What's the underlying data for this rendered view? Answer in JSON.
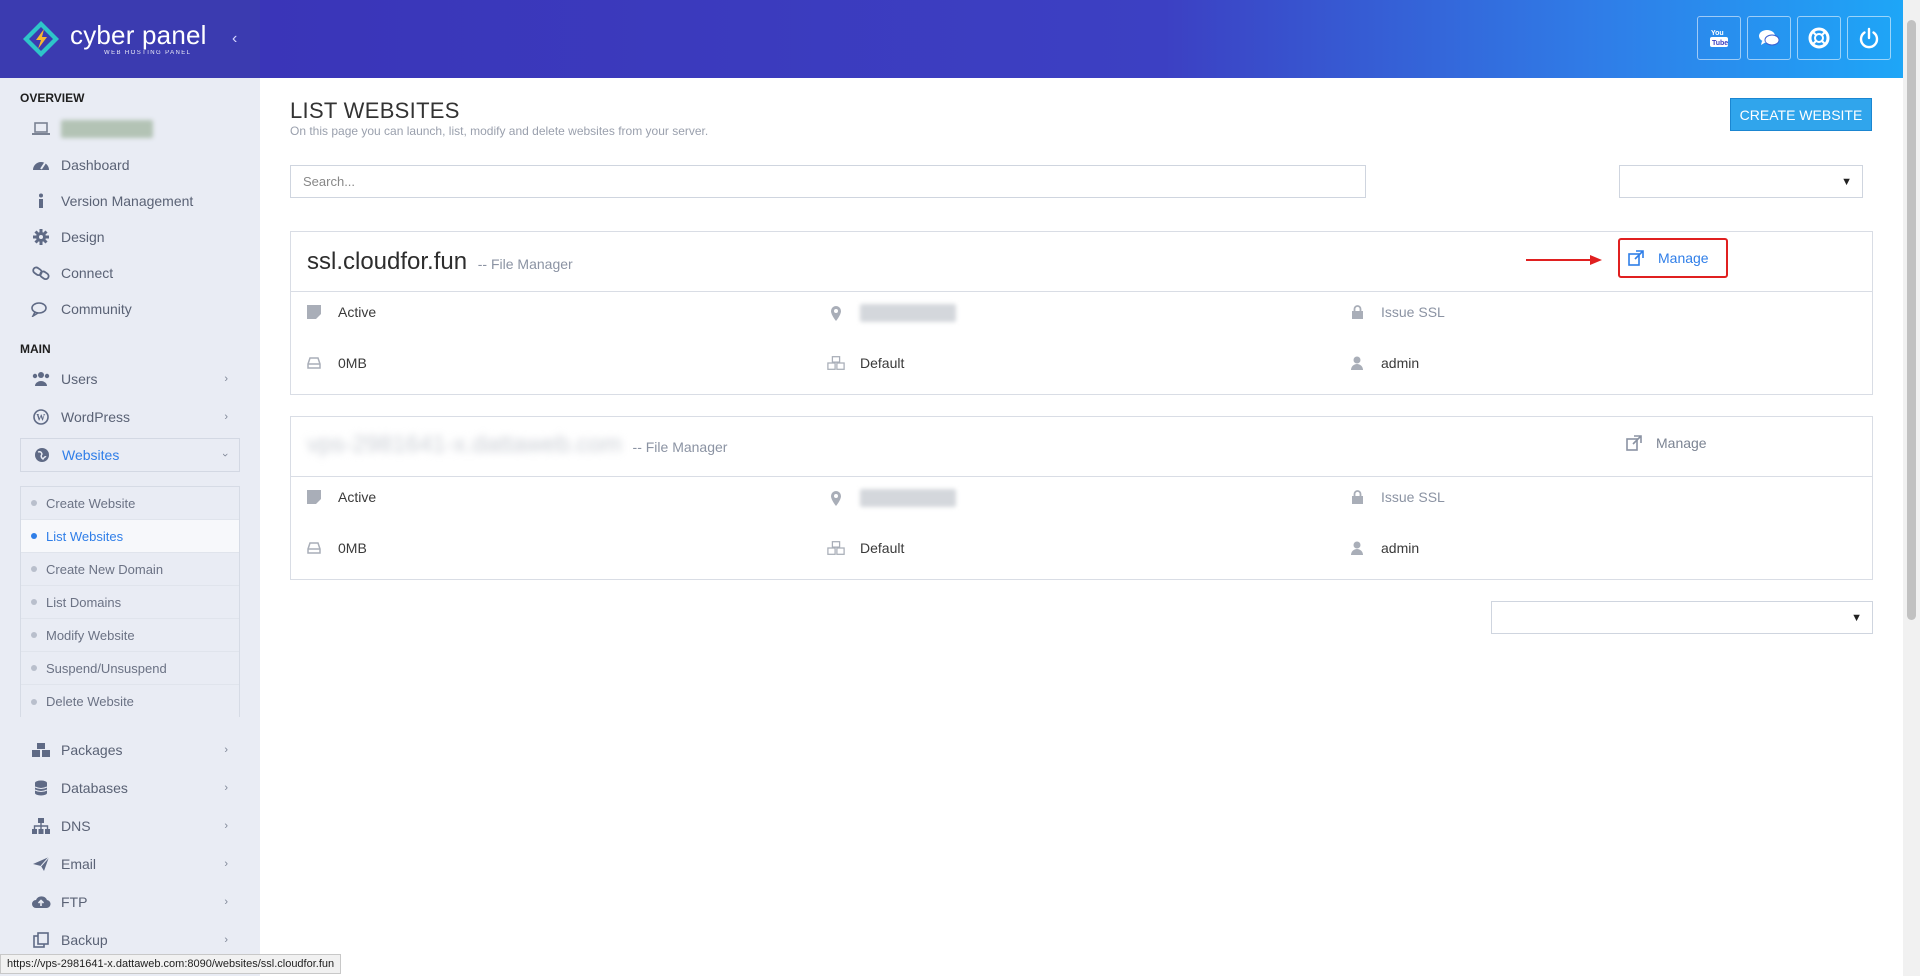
{
  "brand": {
    "name": "cyber panel",
    "tagline": "WEB HOSTING PANEL"
  },
  "header": {
    "actions": [
      {
        "name": "youtube-button",
        "icon": "youtube-icon"
      },
      {
        "name": "chat-button",
        "icon": "chat-icon"
      },
      {
        "name": "support-button",
        "icon": "life-ring-icon"
      },
      {
        "name": "logout-button",
        "icon": "power-icon"
      }
    ]
  },
  "sidebar": {
    "overview_title": "OVERVIEW",
    "overview": [
      {
        "label": "Dashboard",
        "icon": "dashboard-icon"
      },
      {
        "label": "Version Management",
        "icon": "info-icon"
      },
      {
        "label": "Design",
        "icon": "gear-icon"
      },
      {
        "label": "Connect",
        "icon": "link-icon"
      },
      {
        "label": "Community",
        "icon": "comments-icon"
      }
    ],
    "main_title": "MAIN",
    "main": [
      {
        "label": "Users",
        "icon": "users-icon"
      },
      {
        "label": "WordPress",
        "icon": "wordpress-icon"
      },
      {
        "label": "Websites",
        "icon": "globe-icon"
      }
    ],
    "websites_submenu": [
      "Create Website",
      "List Websites",
      "Create New Domain",
      "List Domains",
      "Modify Website",
      "Suspend/Unsuspend",
      "Delete Website"
    ],
    "more": [
      {
        "label": "Packages",
        "icon": "cubes-icon"
      },
      {
        "label": "Databases",
        "icon": "database-icon"
      },
      {
        "label": "DNS",
        "icon": "sitemap-icon"
      },
      {
        "label": "Email",
        "icon": "paper-plane-icon"
      },
      {
        "label": "FTP",
        "icon": "cloud-upload-icon"
      },
      {
        "label": "Backup",
        "icon": "copy-icon"
      }
    ]
  },
  "page": {
    "title": "LIST WEBSITES",
    "description": "On this page you can launch, list, modify and delete websites from your server.",
    "create_button": "CREATE WEBSITE",
    "search_placeholder": "Search..."
  },
  "sites": [
    {
      "domain": "ssl.cloudfor.fun",
      "file_manager": "-- File Manager",
      "manage": "Manage",
      "state": "Active",
      "ssl": "Issue SSL",
      "disk": "0MB",
      "package": "Default",
      "owner": "admin"
    },
    {
      "domain": "vps-2981641-x.dattaweb.com",
      "file_manager": "-- File Manager",
      "manage": "Manage",
      "state": "Active",
      "ssl": "Issue SSL",
      "disk": "0MB",
      "package": "Default",
      "owner": "admin"
    }
  ],
  "status_url": "https://vps-2981641-x.dattaweb.com:8090/websites/ssl.cloudfor.fun",
  "colors": {
    "accent": "#30a5ec",
    "link": "#2f7ee8",
    "highlight": "#e02020",
    "header_start": "#3a35b8",
    "header_end": "#1ea6f7"
  }
}
